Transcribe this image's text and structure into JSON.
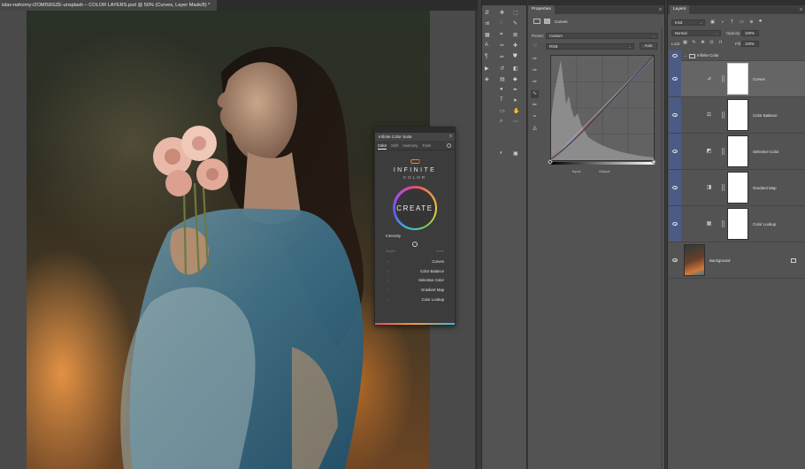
{
  "document": {
    "tab_title": "islav-nahorny-i2OMIS6SZE-unsplash – COLOR LAYERS.psd @ 50% (Curves, Layer Mask/8) *",
    "close": "×"
  },
  "ics_panel": {
    "title": "Infinite Color Suite",
    "menu": "≡",
    "tabs": [
      "Color",
      "Shift",
      "Harmony",
      "Tools"
    ],
    "active_tab": "Color",
    "logo_word": "INFINITE",
    "logo_sub": "COLOR",
    "create_label": "CREATE",
    "intensity_label": "Intensity",
    "col_left": "Shuffle",
    "col_right": "Invert",
    "layers": [
      {
        "label": "Curves"
      },
      {
        "label": "Color Balance"
      },
      {
        "label": "Selective Color"
      },
      {
        "label": "Gradient Map"
      },
      {
        "label": "Color Lookup"
      }
    ],
    "logo_colors": [
      "#e08a3a",
      "#d04848"
    ]
  },
  "properties": {
    "tab": "Properties",
    "menu": "≡",
    "adjustment": "Curves",
    "preset_label": "Preset:",
    "preset_value": "Custom",
    "channel_value": "RGB",
    "auto_label": "Auto",
    "input_label": "Input:",
    "output_label": "Output:"
  },
  "layers": {
    "tab": "Layers",
    "menu": "≡",
    "kind_value": "Kind",
    "blend_mode": "Normal",
    "opacity_label": "Opacity:",
    "opacity_value": "100%",
    "lock_label": "Lock:",
    "fill_label": "Fill:",
    "fill_value": "100%",
    "group_name": "Infinite Color",
    "items": [
      {
        "name": "Curves",
        "icon": "curves-adjustment-icon",
        "selected": true
      },
      {
        "name": "Color Balance",
        "icon": "color-balance-icon",
        "selected": false
      },
      {
        "name": "Selective Color",
        "icon": "selective-color-icon",
        "selected": false
      },
      {
        "name": "Gradient Map",
        "icon": "gradient-map-icon",
        "selected": false
      },
      {
        "name": "Color Lookup",
        "icon": "color-lookup-icon",
        "selected": false
      }
    ],
    "background_name": "Background"
  },
  "colors": {
    "panel": "#535353",
    "dark": "#3a3a3a",
    "selected_eye": "#4a5b86",
    "accent_orange": "#f29a3a"
  }
}
